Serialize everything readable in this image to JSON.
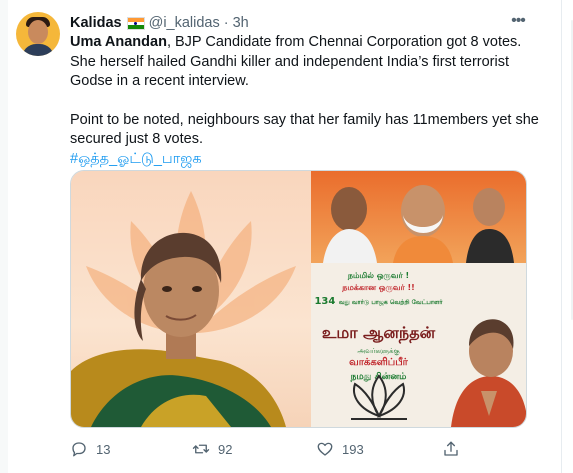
{
  "tweet": {
    "author_name": "Kalidas",
    "author_flag": "indian-flag",
    "author_handle": "@i_kalidas",
    "separator": "·",
    "time": "3h",
    "more_icon": "more-horizontal-icon",
    "body": {
      "p1_bold": "Uma Anandan",
      "p1_rest": ", BJP Candidate from Chennai Corporation got 8 votes. She herself hailed Gandhi killer and independent India’s first terrorist Godse in a recent interview.",
      "p2": "Point to be noted, neighbours say that her family has 11members yet she secured just 8 votes.",
      "hashtag": "#ஒத்த_ஓட்டு_பாஜக"
    },
    "media": {
      "poster_lines": [
        "நம்மில் ஒருவர் !",
        "நமக்கான ஒருவர் !!",
        "134",
        "வது வார்டு பாஜக வெற்றி வேட்பாளர்",
        "உமா ஆனந்தன்",
        "அவர்களுக்கு",
        "வாக்களிப்பீர்",
        "நமது சின்னம்"
      ]
    },
    "actions": {
      "reply_count": "13",
      "retweet_count": "92",
      "like_count": "193"
    }
  },
  "colors": {
    "accent": "#1d9bf0",
    "text": "#0f1419",
    "muted": "#536471",
    "bjp_saffron": "#f08a3a"
  }
}
